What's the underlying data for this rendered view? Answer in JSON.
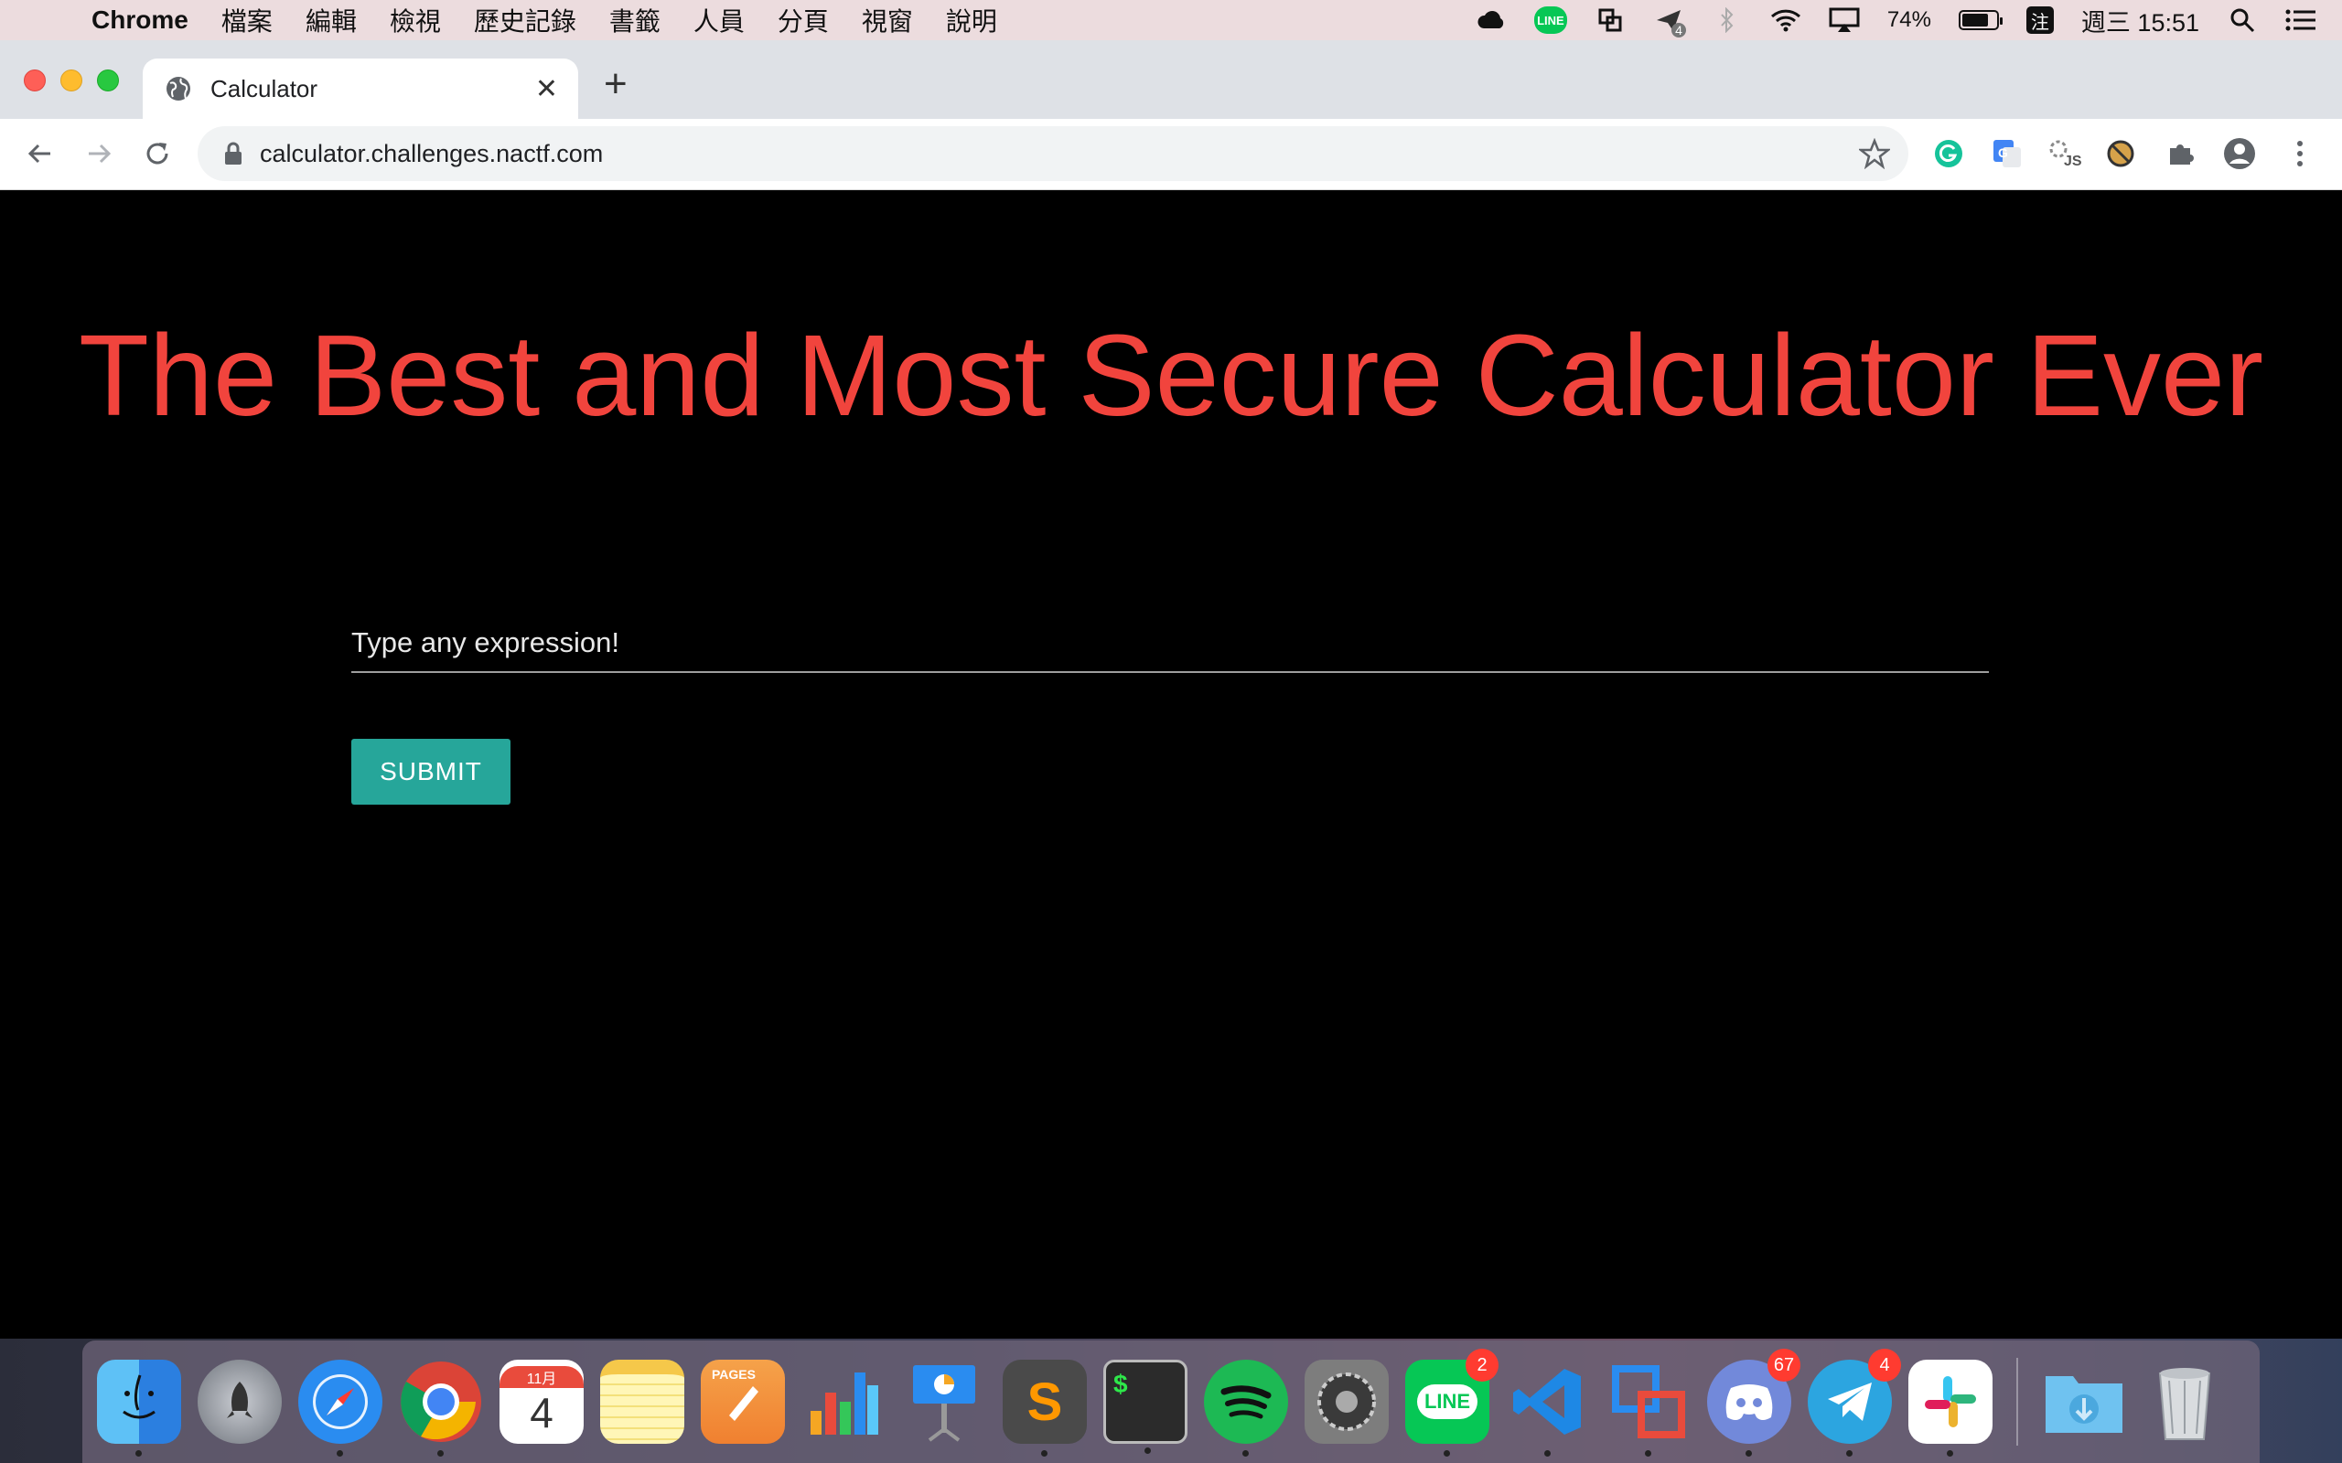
{
  "menubar": {
    "app_name": "Chrome",
    "items": [
      "檔案",
      "編輯",
      "檢視",
      "歷史記錄",
      "書籤",
      "人員",
      "分頁",
      "視窗",
      "說明"
    ],
    "battery_percent": "74%",
    "battery_level": 0.74,
    "datetime": "週三 15:51",
    "line_tray": "LINE",
    "ime_label": "注",
    "tray_badge": "4"
  },
  "browser": {
    "tab_title": "Calculator",
    "url": "calculator.challenges.nactf.com"
  },
  "page": {
    "headline": "The Best and Most Secure Calculator Ever",
    "input_placeholder": "Type any expression!",
    "submit_label": "SUBMIT"
  },
  "colors": {
    "headline": "#f1443d",
    "submit_bg": "#26a69a",
    "page_bg": "#000000"
  },
  "dock": {
    "items": [
      {
        "name": "finder",
        "icon": "finder-icon"
      },
      {
        "name": "launchpad",
        "icon": "rocket-icon"
      },
      {
        "name": "safari",
        "icon": "compass-icon"
      },
      {
        "name": "chrome",
        "icon": "chrome-icon"
      },
      {
        "name": "calendar",
        "icon": "calendar-icon",
        "month": "11月",
        "day": "4"
      },
      {
        "name": "notes",
        "icon": "notes-icon"
      },
      {
        "name": "pages",
        "icon": "pages-icon",
        "label": "PAGES"
      },
      {
        "name": "numbers",
        "icon": "chart-icon"
      },
      {
        "name": "keynote",
        "icon": "keynote-icon"
      },
      {
        "name": "sublime",
        "icon": "sublime-icon",
        "label": "S"
      },
      {
        "name": "terminal",
        "icon": "terminal-icon",
        "label": "$"
      },
      {
        "name": "spotify",
        "icon": "spotify-icon"
      },
      {
        "name": "system-preferences",
        "icon": "gear-icon"
      },
      {
        "name": "line",
        "icon": "line-icon",
        "label": "LINE",
        "badge": "2"
      },
      {
        "name": "vscode",
        "icon": "vscode-icon"
      },
      {
        "name": "vmware",
        "icon": "vmware-icon"
      },
      {
        "name": "discord",
        "icon": "discord-icon",
        "badge": "67"
      },
      {
        "name": "telegram",
        "icon": "telegram-icon",
        "badge": "4"
      },
      {
        "name": "slack",
        "icon": "slack-icon"
      },
      {
        "name": "downloads",
        "icon": "downloads-folder-icon"
      },
      {
        "name": "trash",
        "icon": "trash-icon"
      }
    ]
  }
}
